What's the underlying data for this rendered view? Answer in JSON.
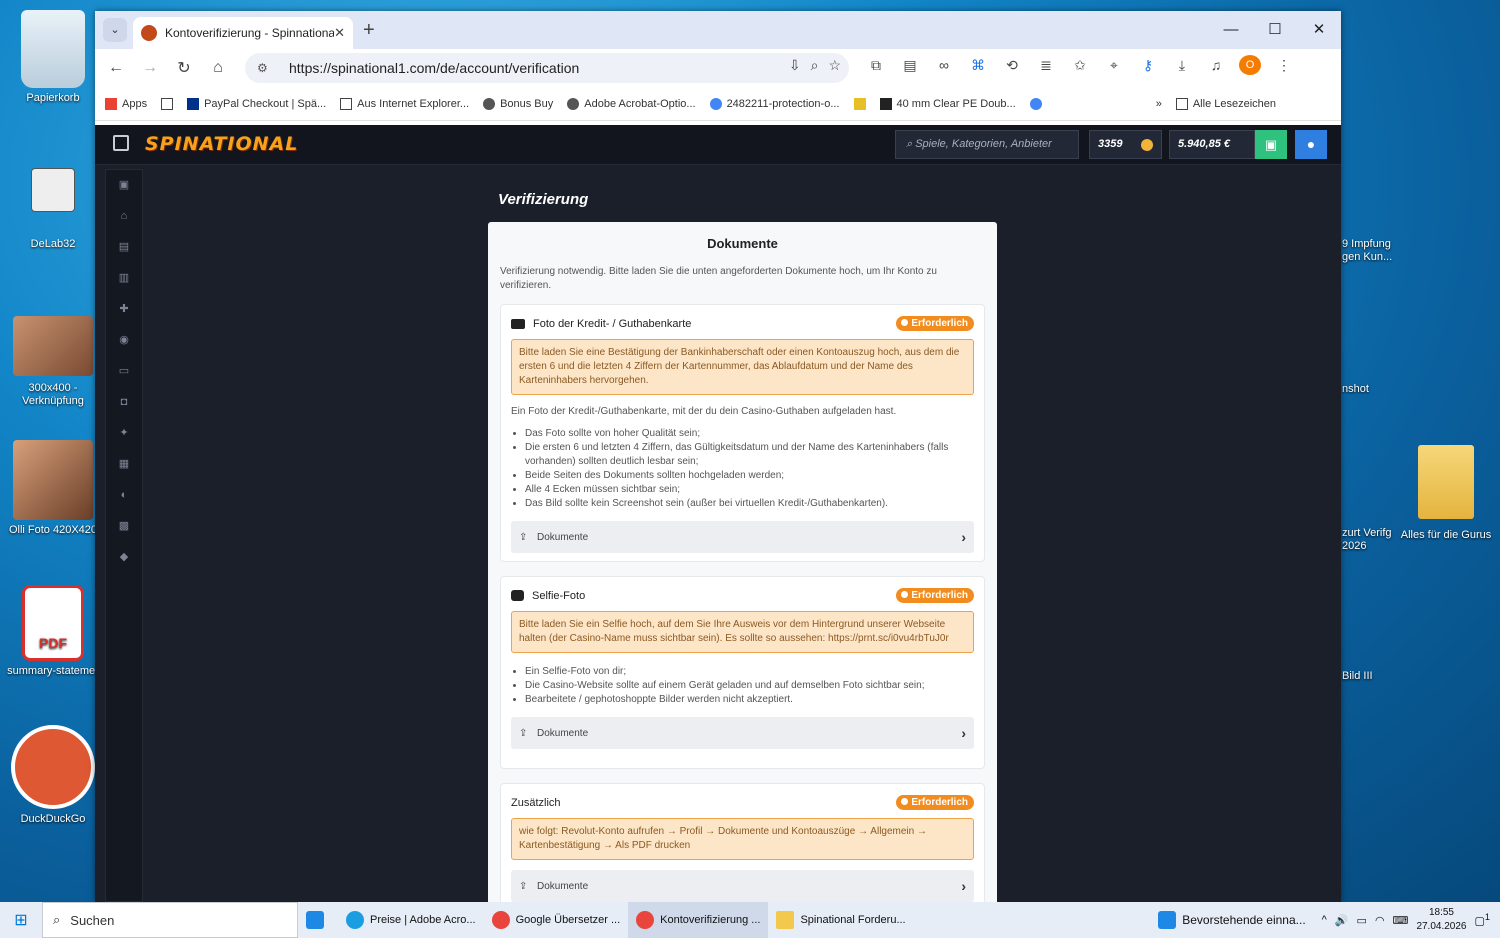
{
  "desktop": {
    "icons": [
      {
        "label": "Papierkorb"
      },
      {
        "label": "DeLab32"
      },
      {
        "label": "300x400 - Verknüpfung"
      },
      {
        "label": "Olli Foto 420X420"
      },
      {
        "label": "summary-statemer"
      },
      {
        "label": "DuckDuckGo"
      },
      {
        "label": "Alles für die Gurus"
      }
    ],
    "partial_labels": [
      "9 Impfung gen Kun...",
      "nshot",
      "zurt Verifg 2026",
      "Bild III"
    ]
  },
  "browser": {
    "tab_title": "Kontoverifizierung - Spinnational",
    "tab_close": "✕",
    "new_tab": "+",
    "url": "https://spinational1.com/de/account/verification",
    "profile_initial": "O",
    "bookmarks": [
      {
        "label": "Apps"
      },
      {
        "label": "PayPal Checkout | Spä..."
      },
      {
        "label": "Aus Internet Explorer..."
      },
      {
        "label": "Bonus Buy"
      },
      {
        "label": "Adobe Acrobat-Optio..."
      },
      {
        "label": "2482211-protection-o..."
      },
      {
        "label": "40 mm Clear PE Doub..."
      },
      {
        "label": "Alle Lesezeichen"
      }
    ]
  },
  "site": {
    "logo": "SPINATIONAL",
    "search_placeholder": "Spiele, Kategorien, Anbieter",
    "coins": "3359",
    "balance": "5.940,85 €",
    "page_title": "Verifizierung"
  },
  "documents": {
    "heading": "Dokumente",
    "intro": "Verifizierung notwendig. Bitte laden Sie die unten angeforderten Dokumente hoch, um Ihr Konto zu verifizieren.",
    "required_label": "Erforderlich",
    "upload_label": "Dokumente",
    "sections": [
      {
        "title": "Foto der Kredit- / Guthabenkarte",
        "notice": "Bitte laden Sie eine Bestätigung der Bankinhaberschaft oder einen Kontoauszug hoch, aus dem die ersten 6 und die letzten 4 Ziffern der Kartennummer, das Ablaufdatum und der Name des Karteninhabers hervorgehen.",
        "description": "Ein Foto der Kredit-/Guthabenkarte, mit der du dein Casino-Guthaben aufgeladen hast.",
        "bullets": [
          "Das Foto sollte von hoher Qualität sein;",
          "Die ersten 6 und letzten 4 Ziffern, das Gültigkeitsdatum und der Name des Karteninhabers (falls vorhanden) sollten deutlich lesbar sein;",
          "Beide Seiten des Dokuments sollten hochgeladen werden;",
          "Alle 4 Ecken müssen sichtbar sein;",
          "Das Bild sollte kein Screenshot sein (außer bei virtuellen Kredit-/Guthabenkarten)."
        ]
      },
      {
        "title": "Selfie-Foto",
        "notice": "Bitte laden Sie ein Selfie hoch, auf dem Sie Ihre Ausweis vor dem Hintergrund unserer Webseite halten (der Casino-Name muss sichtbar sein). Es sollte so aussehen: https://prnt.sc/i0vu4rbTuJ0r",
        "bullets": [
          "Ein Selfie-Foto von dir;",
          "Die Casino-Website sollte auf einem Gerät geladen und auf demselben Foto sichtbar sein;",
          "Bearbeitete / gephotoshoppte Bilder werden nicht akzeptiert."
        ]
      },
      {
        "title": "Zusätzlich",
        "notice": "wie folgt: Revolut-Konto aufrufen → Profil → Dokumente und Kontoauszüge → Allgemein → Kartenbestätigung → Als PDF drucken"
      }
    ]
  },
  "taskbar": {
    "search": "Suchen",
    "apps": [
      {
        "label": "Preise | Adobe Acro..."
      },
      {
        "label": "Google Übersetzer ..."
      },
      {
        "label": "Kontoverifizierung ..."
      },
      {
        "label": "Spinational Forderu..."
      },
      {
        "label": "Bevorstehende einna..."
      }
    ],
    "time": "18:55",
    "date": "27.04.2026",
    "notifications": "1"
  }
}
